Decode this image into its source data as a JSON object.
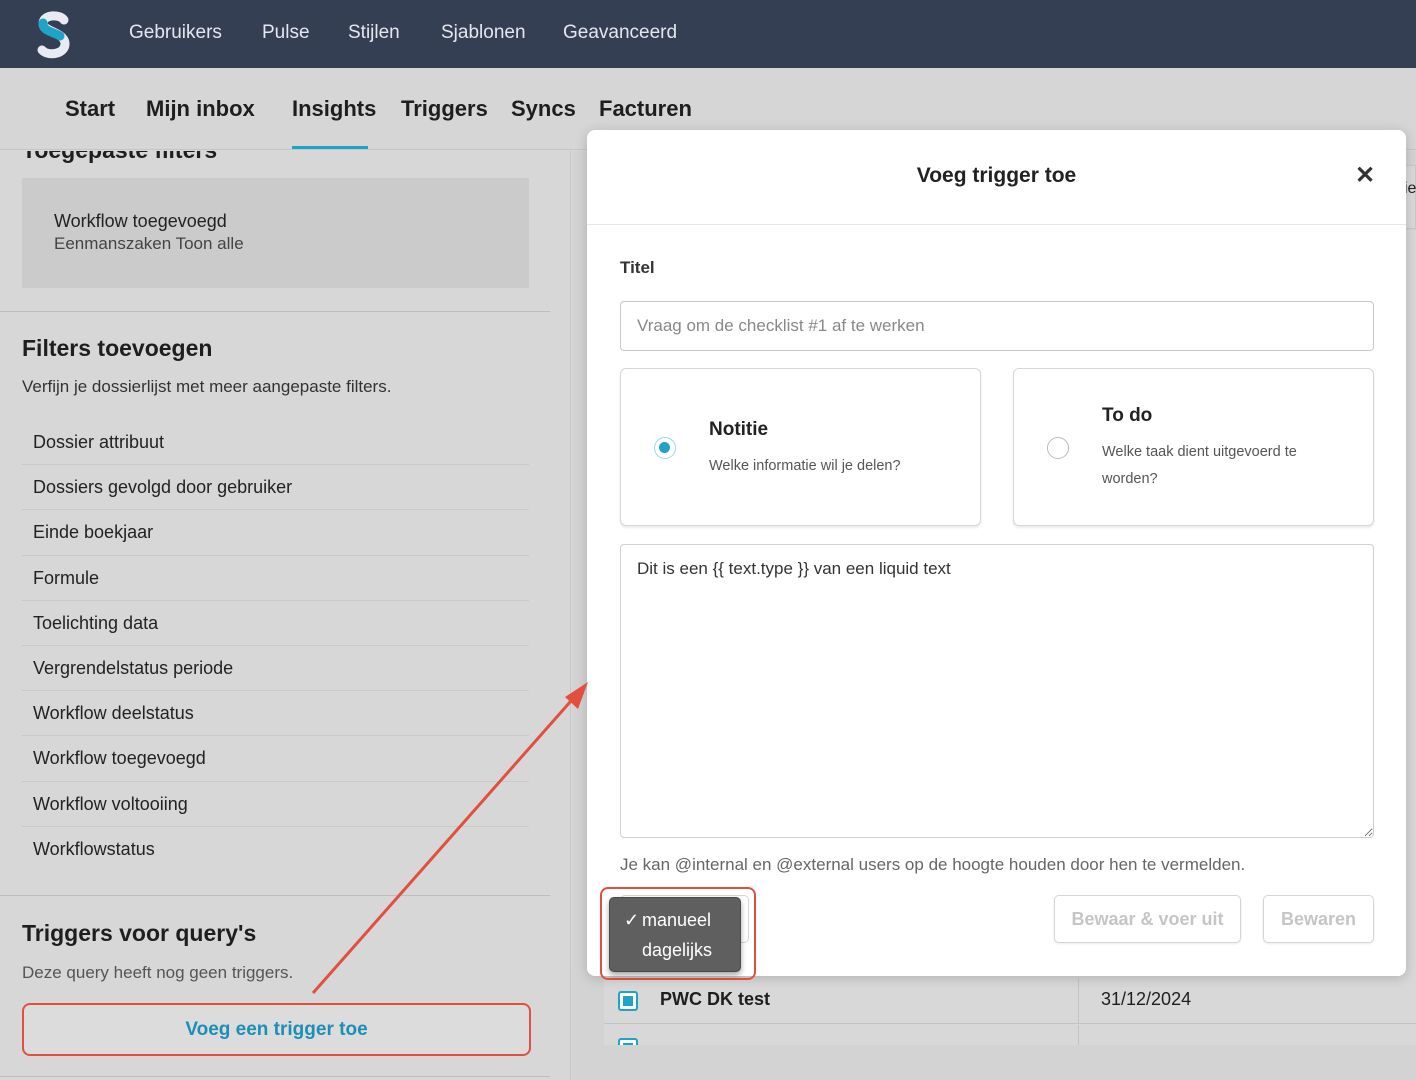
{
  "topnav": {
    "items": [
      "Gebruikers",
      "Pulse",
      "Stijlen",
      "Sjablonen",
      "Geavanceerd"
    ],
    "colors": {
      "bar": "#343f54",
      "logo_accent": "#1fa3c7"
    }
  },
  "subnav": {
    "items": [
      "Start",
      "Mijn inbox",
      "Insights",
      "Triggers",
      "Syncs",
      "Facturen"
    ],
    "active": "Insights"
  },
  "sidebar": {
    "applied_filters": {
      "title": "Toegepaste filters",
      "line1": "Workflow toegevoegd",
      "line2": "Eenmanszaken Toon alle"
    },
    "add_filters": {
      "title": "Filters toevoegen",
      "description": "Verfijn je dossierlijst met meer aangepaste filters.",
      "items": [
        "Dossier attribuut",
        "Dossiers gevolgd door gebruiker",
        "Einde boekjaar",
        "Formule",
        "Toelichting data",
        "Vergrendelstatus periode",
        "Workflow deelstatus",
        "Workflow toegevoegd",
        "Workflow voltooiing",
        "Workflowstatus"
      ]
    },
    "triggers": {
      "title": "Triggers voor query's",
      "description": "Deze query heeft nog geen triggers.",
      "button_label": "Voeg een trigger toe"
    }
  },
  "background_table": {
    "header_fragment": "ie",
    "rows": [
      {
        "name": "PWC DK test",
        "date": "31/12/2024"
      }
    ]
  },
  "modal": {
    "title": "Voeg trigger toe",
    "close_symbol": "✕",
    "title_label": "Titel",
    "title_placeholder": "Vraag om de checklist #1 af te werken",
    "options": [
      {
        "title": "Notitie",
        "description": "Welke informatie wil je delen?",
        "selected": true
      },
      {
        "title": "To do",
        "description": "Welke taak dient uitgevoerd te worden?",
        "selected": false
      }
    ],
    "message_value": "Dit is een {{ text.type }} van een liquid text",
    "hint": "Je kan @internal en @external users op de hoogte houden door hen te vermelden.",
    "buttons": {
      "save_run": "Bewaar & voer uit",
      "save": "Bewaren"
    },
    "frequency": {
      "options": [
        "manueel",
        "dagelijks"
      ],
      "selected": "manueel",
      "check_mark": "✓"
    }
  },
  "colors": {
    "accent": "#1fa3c7",
    "annotation": "#e1503f"
  }
}
